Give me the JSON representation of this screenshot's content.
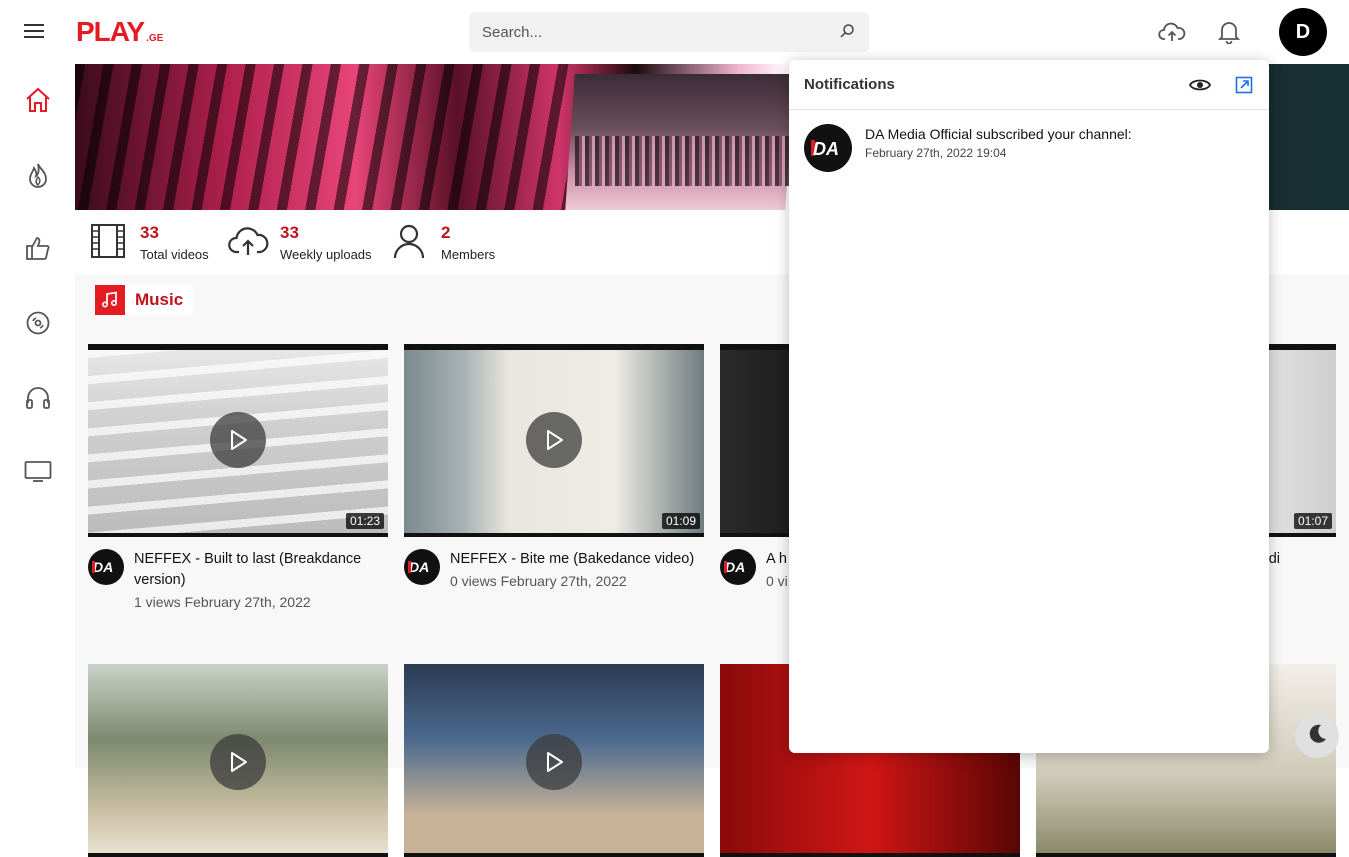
{
  "header": {
    "logo_text": "PLAY",
    "logo_suffix": ".GE",
    "search_placeholder": "Search...",
    "avatar_letter": "D"
  },
  "sidebar": {
    "items": [
      {
        "icon": "home-icon",
        "active": true
      },
      {
        "icon": "fire-icon"
      },
      {
        "icon": "thumbs-up-icon"
      },
      {
        "icon": "disc-icon"
      },
      {
        "icon": "headphones-icon"
      },
      {
        "icon": "tv-icon"
      }
    ]
  },
  "stats": {
    "total_videos": {
      "value": "33",
      "label": "Total videos"
    },
    "weekly_uploads": {
      "value": "33",
      "label": "Weekly uploads"
    },
    "members": {
      "value": "2",
      "label": "Members"
    }
  },
  "category": {
    "label": "Music"
  },
  "videos": [
    {
      "title": "NEFFEX - Built to last (Breakdance version)",
      "sub": "1 views February 27th, 2022",
      "duration": "01:23"
    },
    {
      "title": "NEFFEX - Bite me (Bakedance video)",
      "sub": "0 views February 27th, 2022",
      "duration": "01:09"
    },
    {
      "title": "A h",
      "sub": "0 vi",
      "duration": ""
    },
    {
      "title": "endi",
      "sub": "",
      "duration": "01:07"
    }
  ],
  "notifications": {
    "title": "Notifications",
    "items": [
      {
        "avatar_text": "DA",
        "message": "DA Media Official subscribed your channel:",
        "time": "February 27th, 2022 19:04"
      }
    ]
  },
  "channel_avatar_text": "DA",
  "colors": {
    "brand": "#e31b23",
    "accent_dark": "#c0141c",
    "link_blue": "#1a73e8"
  }
}
